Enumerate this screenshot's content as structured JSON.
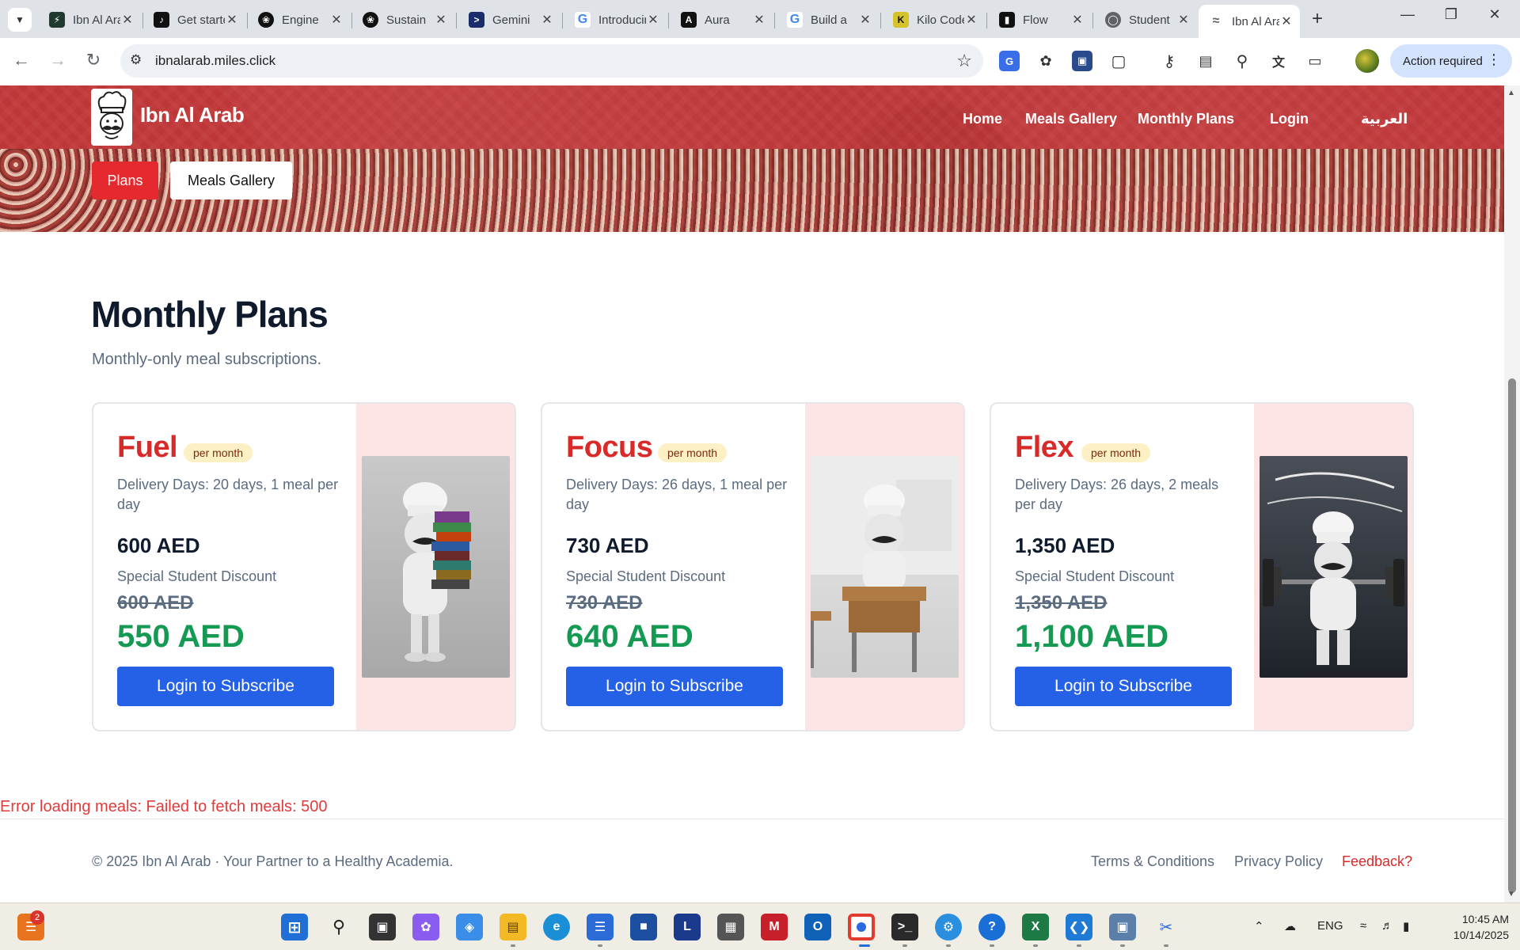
{
  "browser": {
    "tabs": [
      {
        "title": "Ibn Al Arab",
        "icon": "lightning-icon",
        "color": "#1f3a2e"
      },
      {
        "title": "Get started",
        "icon": "tiktok-icon",
        "color": "#111111"
      },
      {
        "title": "Engine",
        "icon": "openai-icon",
        "color": "#111111"
      },
      {
        "title": "Sustain",
        "icon": "openai-icon",
        "color": "#111111"
      },
      {
        "title": "Gemini",
        "icon": "terminal-icon",
        "color": "#1a2c6b"
      },
      {
        "title": "Introducing",
        "icon": "google-icon",
        "color": "#4285f4"
      },
      {
        "title": "Aura",
        "icon": "aura-icon",
        "color": "#111111"
      },
      {
        "title": "Build a",
        "icon": "google-icon",
        "color": "#4285f4"
      },
      {
        "title": "Kilo Code",
        "icon": "kilo-icon",
        "color": "#d4c32a"
      },
      {
        "title": "Flow",
        "icon": "flow-icon",
        "color": "#111111"
      },
      {
        "title": "Student",
        "icon": "globe-icon",
        "color": "#5f6368"
      },
      {
        "title": "Ibn Al Arab",
        "icon": "wifi-icon",
        "color": "#5f6368",
        "active": true
      }
    ],
    "url": "ibnalarab.miles.click",
    "action_required": "Action required"
  },
  "site": {
    "brand": "Ibn Al Arab",
    "nav": {
      "home": "Home",
      "meals_gallery": "Meals Gallery",
      "monthly_plans": "Monthly Plans",
      "login": "Login",
      "arabic": "العربية"
    },
    "pills": {
      "plans": "Plans",
      "meals_gallery": "Meals Gallery"
    },
    "page_title": "Monthly Plans",
    "page_subtitle": "Monthly-only meal subscriptions.",
    "plans": [
      {
        "name": "Fuel",
        "badge": "per month",
        "delivery": "Delivery Days: 20 days, 1 meal per day",
        "price": "600 AED",
        "discount_label": "Special Student Discount",
        "old_price": "600 AED",
        "new_price": "550 AED",
        "button": "Login to Subscribe",
        "image": "chef-with-books"
      },
      {
        "name": "Focus",
        "badge": "per month",
        "delivery": "Delivery Days: 26 days, 1 meal per day",
        "price": "730 AED",
        "discount_label": "Special Student Discount",
        "old_price": "730 AED",
        "new_price": "640 AED",
        "button": "Login to Subscribe",
        "image": "chef-at-desk"
      },
      {
        "name": "Flex",
        "badge": "per month",
        "delivery": "Delivery Days: 26 days, 2 meals per day",
        "price": "1,350 AED",
        "discount_label": "Special Student Discount",
        "old_price": "1,350 AED",
        "new_price": "1,100 AED",
        "button": "Login to Subscribe",
        "image": "chef-lifting-weights"
      }
    ],
    "error": "Error loading meals: Failed to fetch meals: 500",
    "footer": {
      "copyright": "© 2025 Ibn Al Arab · Your Partner to a Healthy Academia.",
      "terms": "Terms & Conditions",
      "privacy": "Privacy Policy",
      "feedback": "Feedback?"
    }
  },
  "colors": {
    "accent_red": "#d92a2a",
    "button_blue": "#2461e6",
    "discount_green": "#149a52"
  },
  "taskbar": {
    "notification_count": "2",
    "language": "ENG",
    "time": "10:45 AM",
    "date": "10/14/2025"
  }
}
